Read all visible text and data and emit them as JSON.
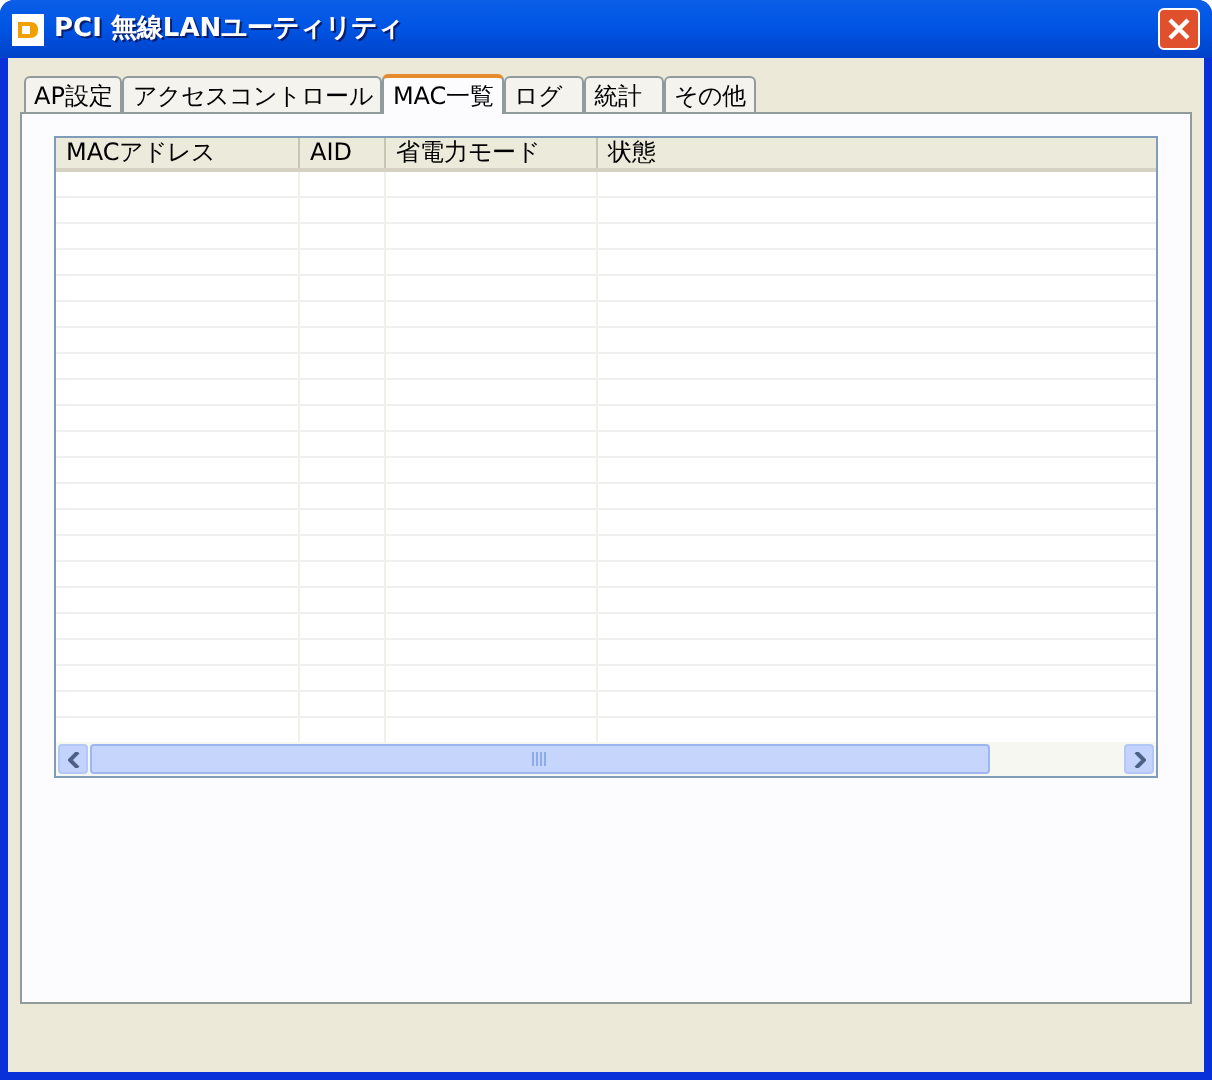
{
  "window": {
    "title": "PCI 無線LANユーティリティ"
  },
  "tabs": [
    {
      "label": "AP設定",
      "selected": false
    },
    {
      "label": "アクセスコントロール",
      "selected": false
    },
    {
      "label": "MAC一覧",
      "selected": true
    },
    {
      "label": "ログ",
      "selected": false
    },
    {
      "label": "統計",
      "selected": false
    },
    {
      "label": "その他",
      "selected": false
    }
  ],
  "table": {
    "columns": [
      "MACアドレス",
      "AID",
      "省電力モード",
      "状態"
    ]
  }
}
